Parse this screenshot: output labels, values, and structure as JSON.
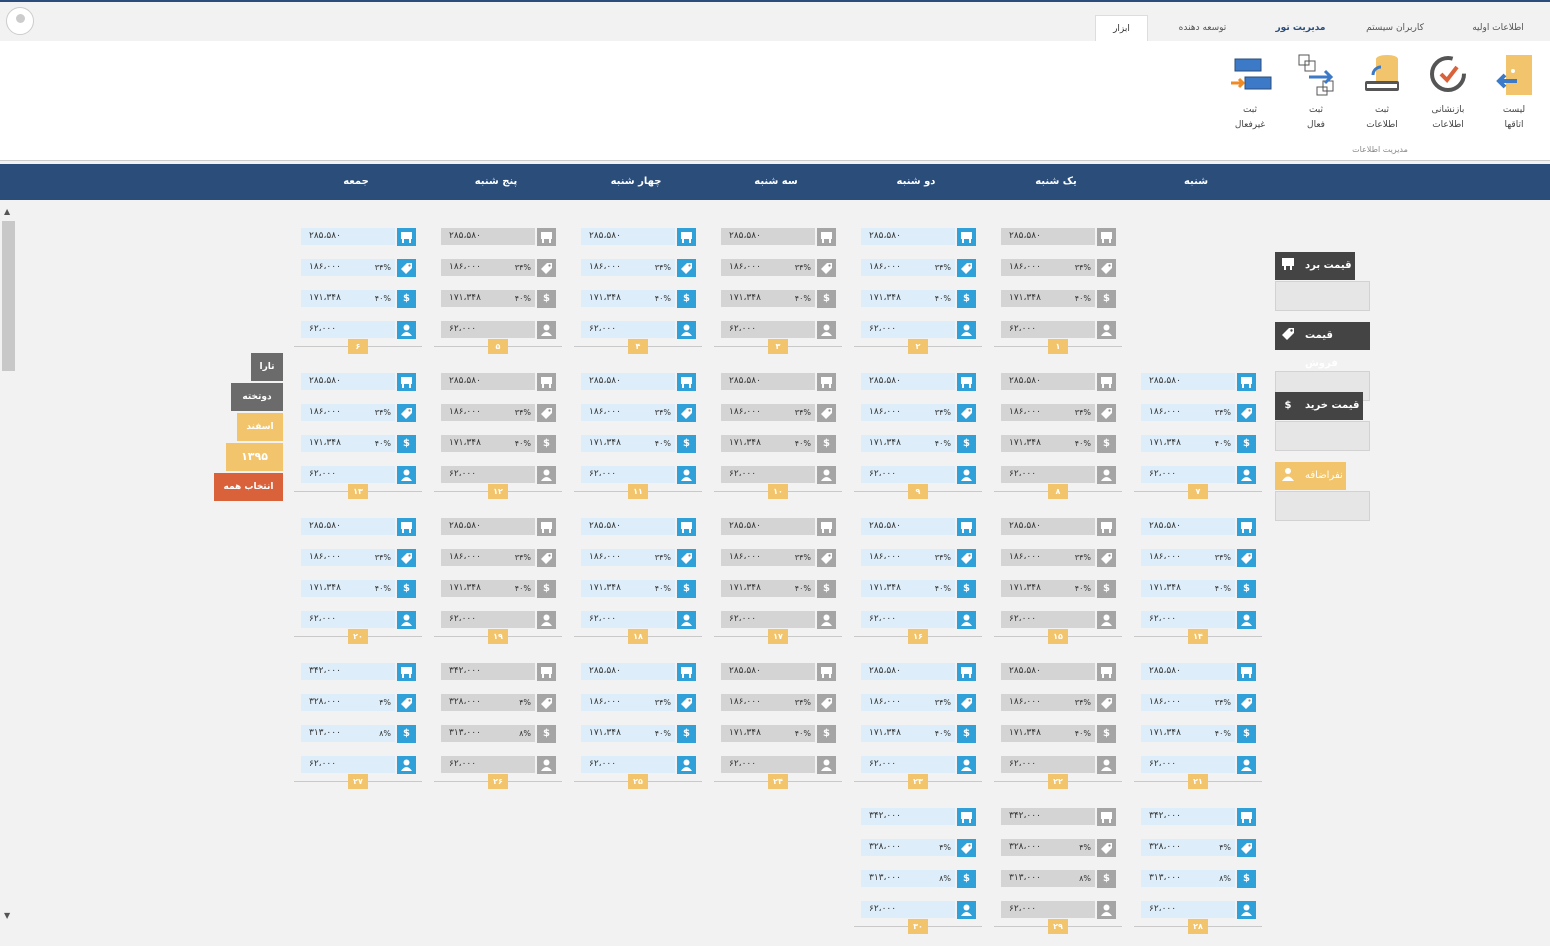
{
  "tabs": [
    "اطلاعات اولیه",
    "کاربران سیستم",
    "مدیریت تور",
    "توسعه دهنده",
    "ابزار"
  ],
  "ribbon": {
    "buttons": [
      {
        "line1": "لیست",
        "line2": "اتاقها"
      },
      {
        "line1": "بازنشانی",
        "line2": "اطلاعات"
      },
      {
        "line1": "ثبت",
        "line2": "اطلاعات"
      },
      {
        "line1": "ثبت",
        "line2": "فعال"
      },
      {
        "line1": "ثبت",
        "line2": "غیرفعال"
      }
    ],
    "group_label": "مدیریت اطلاعات"
  },
  "days": [
    "شنبه",
    "یک شنبه",
    "دو شنبه",
    "سه شنبه",
    "چهار شنبه",
    "پنج شنبه",
    "جمعه"
  ],
  "legend": {
    "board": "قیمت برد",
    "sell": "قیمت فروش",
    "buy": "قیمت خرید",
    "extra": "نفراضافه"
  },
  "side": {
    "to": "تارا",
    "from": "دوتخته",
    "month": "اسفند",
    "year": "۱۳۹۵",
    "select_all": "انتخاب همه"
  },
  "cells": [
    {
      "n": "۱",
      "a": "۲۸۵،۵۸۰",
      "b": "۱۸۶،۰۰۰",
      "bp": "۳۴%",
      "c": "۱۷۱،۳۴۸",
      "cp": "۴۰%",
      "d": "۶۲،۰۰۰"
    },
    {
      "n": "۲",
      "a": "۲۸۵،۵۸۰",
      "b": "۱۸۶،۰۰۰",
      "bp": "۳۴%",
      "c": "۱۷۱،۳۴۸",
      "cp": "۴۰%",
      "d": "۶۲،۰۰۰"
    },
    {
      "n": "۳",
      "a": "۲۸۵،۵۸۰",
      "b": "۱۸۶،۰۰۰",
      "bp": "۳۴%",
      "c": "۱۷۱،۳۴۸",
      "cp": "۴۰%",
      "d": "۶۲،۰۰۰"
    },
    {
      "n": "۴",
      "a": "۲۸۵،۵۸۰",
      "b": "۱۸۶،۰۰۰",
      "bp": "۳۴%",
      "c": "۱۷۱،۳۴۸",
      "cp": "۴۰%",
      "d": "۶۲،۰۰۰"
    },
    {
      "n": "۵",
      "a": "۲۸۵،۵۸۰",
      "b": "۱۸۶،۰۰۰",
      "bp": "۳۴%",
      "c": "۱۷۱،۳۴۸",
      "cp": "۴۰%",
      "d": "۶۲،۰۰۰"
    },
    {
      "n": "۶",
      "a": "۲۸۵،۵۸۰",
      "b": "۱۸۶،۰۰۰",
      "bp": "۳۴%",
      "c": "۱۷۱،۳۴۸",
      "cp": "۴۰%",
      "d": "۶۲،۰۰۰"
    },
    {
      "n": "۷",
      "a": "۲۸۵،۵۸۰",
      "b": "۱۸۶،۰۰۰",
      "bp": "۳۴%",
      "c": "۱۷۱،۳۴۸",
      "cp": "۴۰%",
      "d": "۶۲،۰۰۰"
    },
    {
      "n": "۸",
      "a": "۲۸۵،۵۸۰",
      "b": "۱۸۶،۰۰۰",
      "bp": "۳۴%",
      "c": "۱۷۱،۳۴۸",
      "cp": "۴۰%",
      "d": "۶۲،۰۰۰"
    },
    {
      "n": "۹",
      "a": "۲۸۵،۵۸۰",
      "b": "۱۸۶،۰۰۰",
      "bp": "۳۴%",
      "c": "۱۷۱،۳۴۸",
      "cp": "۴۰%",
      "d": "۶۲،۰۰۰"
    },
    {
      "n": "۱۰",
      "a": "۲۸۵،۵۸۰",
      "b": "۱۸۶،۰۰۰",
      "bp": "۳۴%",
      "c": "۱۷۱،۳۴۸",
      "cp": "۴۰%",
      "d": "۶۲،۰۰۰"
    },
    {
      "n": "۱۱",
      "a": "۲۸۵،۵۸۰",
      "b": "۱۸۶،۰۰۰",
      "bp": "۳۴%",
      "c": "۱۷۱،۳۴۸",
      "cp": "۴۰%",
      "d": "۶۲،۰۰۰"
    },
    {
      "n": "۱۲",
      "a": "۲۸۵،۵۸۰",
      "b": "۱۸۶،۰۰۰",
      "bp": "۳۴%",
      "c": "۱۷۱،۳۴۸",
      "cp": "۴۰%",
      "d": "۶۲،۰۰۰"
    },
    {
      "n": "۱۳",
      "a": "۲۸۵،۵۸۰",
      "b": "۱۸۶،۰۰۰",
      "bp": "۳۴%",
      "c": "۱۷۱،۳۴۸",
      "cp": "۴۰%",
      "d": "۶۲،۰۰۰"
    },
    {
      "n": "۱۴",
      "a": "۲۸۵،۵۸۰",
      "b": "۱۸۶،۰۰۰",
      "bp": "۳۴%",
      "c": "۱۷۱،۳۴۸",
      "cp": "۴۰%",
      "d": "۶۲،۰۰۰"
    },
    {
      "n": "۱۵",
      "a": "۲۸۵،۵۸۰",
      "b": "۱۸۶،۰۰۰",
      "bp": "۳۴%",
      "c": "۱۷۱،۳۴۸",
      "cp": "۴۰%",
      "d": "۶۲،۰۰۰"
    },
    {
      "n": "۱۶",
      "a": "۲۸۵،۵۸۰",
      "b": "۱۸۶،۰۰۰",
      "bp": "۳۴%",
      "c": "۱۷۱،۳۴۸",
      "cp": "۴۰%",
      "d": "۶۲،۰۰۰"
    },
    {
      "n": "۱۷",
      "a": "۲۸۵،۵۸۰",
      "b": "۱۸۶،۰۰۰",
      "bp": "۳۴%",
      "c": "۱۷۱،۳۴۸",
      "cp": "۴۰%",
      "d": "۶۲،۰۰۰"
    },
    {
      "n": "۱۸",
      "a": "۲۸۵،۵۸۰",
      "b": "۱۸۶،۰۰۰",
      "bp": "۳۴%",
      "c": "۱۷۱،۳۴۸",
      "cp": "۴۰%",
      "d": "۶۲،۰۰۰"
    },
    {
      "n": "۱۹",
      "a": "۲۸۵،۵۸۰",
      "b": "۱۸۶،۰۰۰",
      "bp": "۳۴%",
      "c": "۱۷۱،۳۴۸",
      "cp": "۴۰%",
      "d": "۶۲،۰۰۰"
    },
    {
      "n": "۲۰",
      "a": "۲۸۵،۵۸۰",
      "b": "۱۸۶،۰۰۰",
      "bp": "۳۴%",
      "c": "۱۷۱،۳۴۸",
      "cp": "۴۰%",
      "d": "۶۲،۰۰۰"
    },
    {
      "n": "۲۱",
      "a": "۲۸۵،۵۸۰",
      "b": "۱۸۶،۰۰۰",
      "bp": "۳۴%",
      "c": "۱۷۱،۳۴۸",
      "cp": "۴۰%",
      "d": "۶۲،۰۰۰"
    },
    {
      "n": "۲۲",
      "a": "۲۸۵،۵۸۰",
      "b": "۱۸۶،۰۰۰",
      "bp": "۳۴%",
      "c": "۱۷۱،۳۴۸",
      "cp": "۴۰%",
      "d": "۶۲،۰۰۰"
    },
    {
      "n": "۲۳",
      "a": "۲۸۵،۵۸۰",
      "b": "۱۸۶،۰۰۰",
      "bp": "۳۴%",
      "c": "۱۷۱،۳۴۸",
      "cp": "۴۰%",
      "d": "۶۲،۰۰۰"
    },
    {
      "n": "۲۴",
      "a": "۲۸۵،۵۸۰",
      "b": "۱۸۶،۰۰۰",
      "bp": "۳۴%",
      "c": "۱۷۱،۳۴۸",
      "cp": "۴۰%",
      "d": "۶۲،۰۰۰"
    },
    {
      "n": "۲۵",
      "a": "۲۸۵،۵۸۰",
      "b": "۱۸۶،۰۰۰",
      "bp": "۳۴%",
      "c": "۱۷۱،۳۴۸",
      "cp": "۴۰%",
      "d": "۶۲،۰۰۰"
    },
    {
      "n": "۲۶",
      "a": "۳۴۲،۰۰۰",
      "b": "۳۲۸،۰۰۰",
      "bp": "۴%",
      "c": "۳۱۳،۰۰۰",
      "cp": "۸%",
      "d": "۶۲،۰۰۰"
    },
    {
      "n": "۲۷",
      "a": "۳۴۲،۰۰۰",
      "b": "۳۲۸،۰۰۰",
      "bp": "۴%",
      "c": "۳۱۳،۰۰۰",
      "cp": "۸%",
      "d": "۶۲،۰۰۰"
    },
    {
      "n": "۲۸",
      "a": "۳۴۲،۰۰۰",
      "b": "۳۲۸،۰۰۰",
      "bp": "۴%",
      "c": "۳۱۳،۰۰۰",
      "cp": "۸%",
      "d": "۶۲،۰۰۰"
    },
    {
      "n": "۲۹",
      "a": "۳۴۲،۰۰۰",
      "b": "۳۲۸،۰۰۰",
      "bp": "۴%",
      "c": "۳۱۳،۰۰۰",
      "cp": "۸%",
      "d": "۶۲،۰۰۰"
    },
    {
      "n": "۳۰",
      "a": "۳۴۲،۰۰۰",
      "b": "۳۲۸،۰۰۰",
      "bp": "۴%",
      "c": "۳۱۳،۰۰۰",
      "cp": "۸%",
      "d": "۶۲،۰۰۰"
    }
  ],
  "colors": {
    "header": "#2a4d7a",
    "blue_icon": "#2fa0d8",
    "gray_icon": "#a5a5a5",
    "badge": "#f2c46b",
    "select_all": "#d9623b"
  }
}
